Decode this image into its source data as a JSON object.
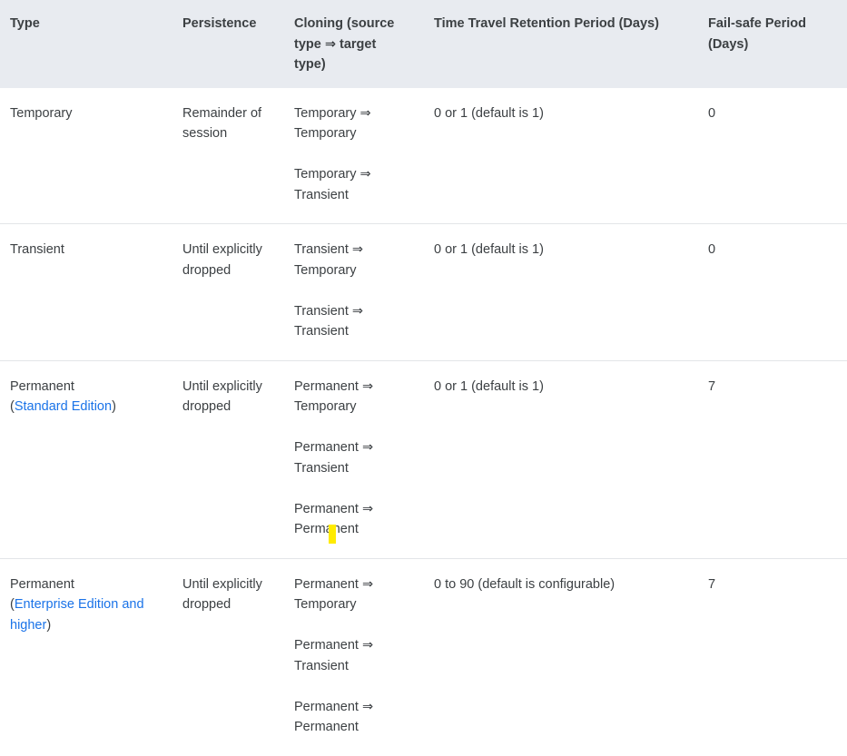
{
  "table": {
    "headers": [
      "Type",
      "Persistence",
      "Cloning (source type ⇒ target type)",
      "Time Travel Retention Period (Days)",
      "Fail-safe Period (Days)"
    ],
    "rows": [
      {
        "type": "Temporary",
        "type_link": null,
        "type_link_suffix": null,
        "persistence": "Remainder of session",
        "cloning": [
          "Temporary ⇒ Temporary",
          "Temporary ⇒ Transient"
        ],
        "time_travel": "0 or 1 (default is 1)",
        "fail_safe": "0"
      },
      {
        "type": "Transient",
        "type_link": null,
        "type_link_suffix": null,
        "persistence": "Until explicitly dropped",
        "cloning": [
          "Transient ⇒ Temporary",
          "Transient ⇒ Transient"
        ],
        "time_travel": "0 or 1 (default is 1)",
        "fail_safe": "0"
      },
      {
        "type": "Permanent",
        "type_link": "Standard Edition",
        "type_link_suffix": null,
        "persistence": "Until explicitly dropped",
        "cloning": [
          "Permanent ⇒ Temporary",
          "Permanent ⇒ Transient",
          "Permanent ⇒ Permanent"
        ],
        "time_travel": "0 or 1 (default is 1)",
        "fail_safe": "7"
      },
      {
        "type": "Permanent",
        "type_link": "Enterprise Edition and higher",
        "type_link_suffix": null,
        "persistence": "Until explicitly dropped",
        "cloning": [
          "Permanent ⇒ Temporary",
          "Permanent ⇒ Transient",
          "Permanent ⇒ Permanent"
        ],
        "time_travel": "0 to 90 (default is configurable)",
        "fail_safe": "7"
      }
    ],
    "paren_open": "(",
    "paren_close": ")"
  },
  "colors": {
    "header_background": "#e8ebf0",
    "link": "#1a73e8",
    "text": "#3c4043",
    "row_divider": "#e3e5e8",
    "caret_highlight": "#ffeb00"
  }
}
